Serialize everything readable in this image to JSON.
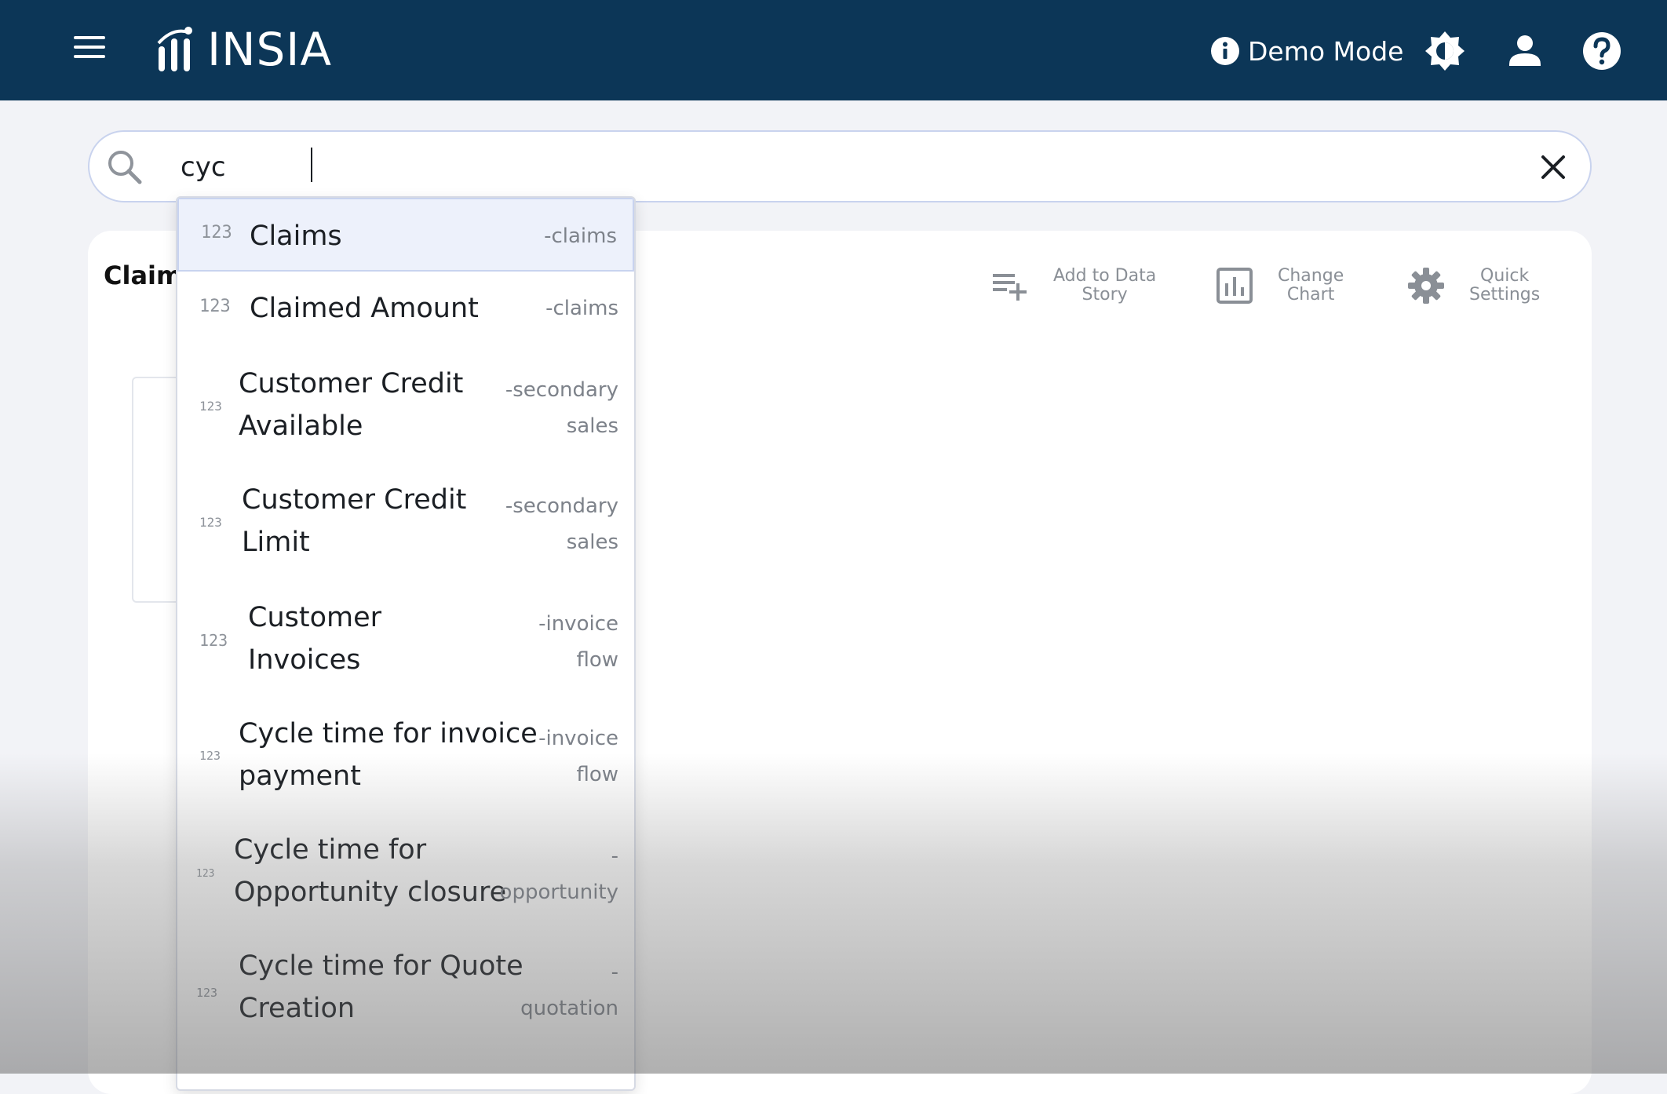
{
  "header": {
    "logo_text": "INSIA",
    "demo_mode_label": "Demo Mode"
  },
  "search": {
    "value": "cyc",
    "placeholder": ""
  },
  "card": {
    "title": "Claim",
    "toolbar": {
      "add_to_story_line1": "Add to Data",
      "add_to_story_line2": "Story",
      "change_chart_line1": "Change",
      "change_chart_line2": "Chart",
      "quick_settings_line1": "Quick",
      "quick_settings_line2": "Settings"
    }
  },
  "suggestions": [
    {
      "type": "123",
      "name_line1": "Claims",
      "name_line2": "",
      "source_line1": "-claims",
      "source_line2": ""
    },
    {
      "type": "123",
      "name_line1": "Claimed Amount",
      "name_line2": "",
      "source_line1": "-claims",
      "source_line2": ""
    },
    {
      "type": "123",
      "name_line1": "Customer Credit",
      "name_line2": "Available",
      "source_line1": "-secondary",
      "source_line2": "sales"
    },
    {
      "type": "123",
      "name_line1": "Customer Credit",
      "name_line2": "Limit",
      "source_line1": "-secondary",
      "source_line2": "sales"
    },
    {
      "type": "123",
      "name_line1": "Customer",
      "name_line2": "Invoices",
      "source_line1": "-invoice",
      "source_line2": "flow"
    },
    {
      "type": "123",
      "name_line1": "Cycle time for invoice",
      "name_line2": "payment",
      "source_line1": "-invoice",
      "source_line2": "flow"
    },
    {
      "type": "123",
      "name_line1": "Cycle time for",
      "name_line2": "Opportunity closure",
      "source_line1": "-",
      "source_line2": "opportunity"
    },
    {
      "type": "123",
      "name_line1": "Cycle time for Quote",
      "name_line2": "Creation",
      "source_line1": "-",
      "source_line2": "quotation"
    }
  ]
}
